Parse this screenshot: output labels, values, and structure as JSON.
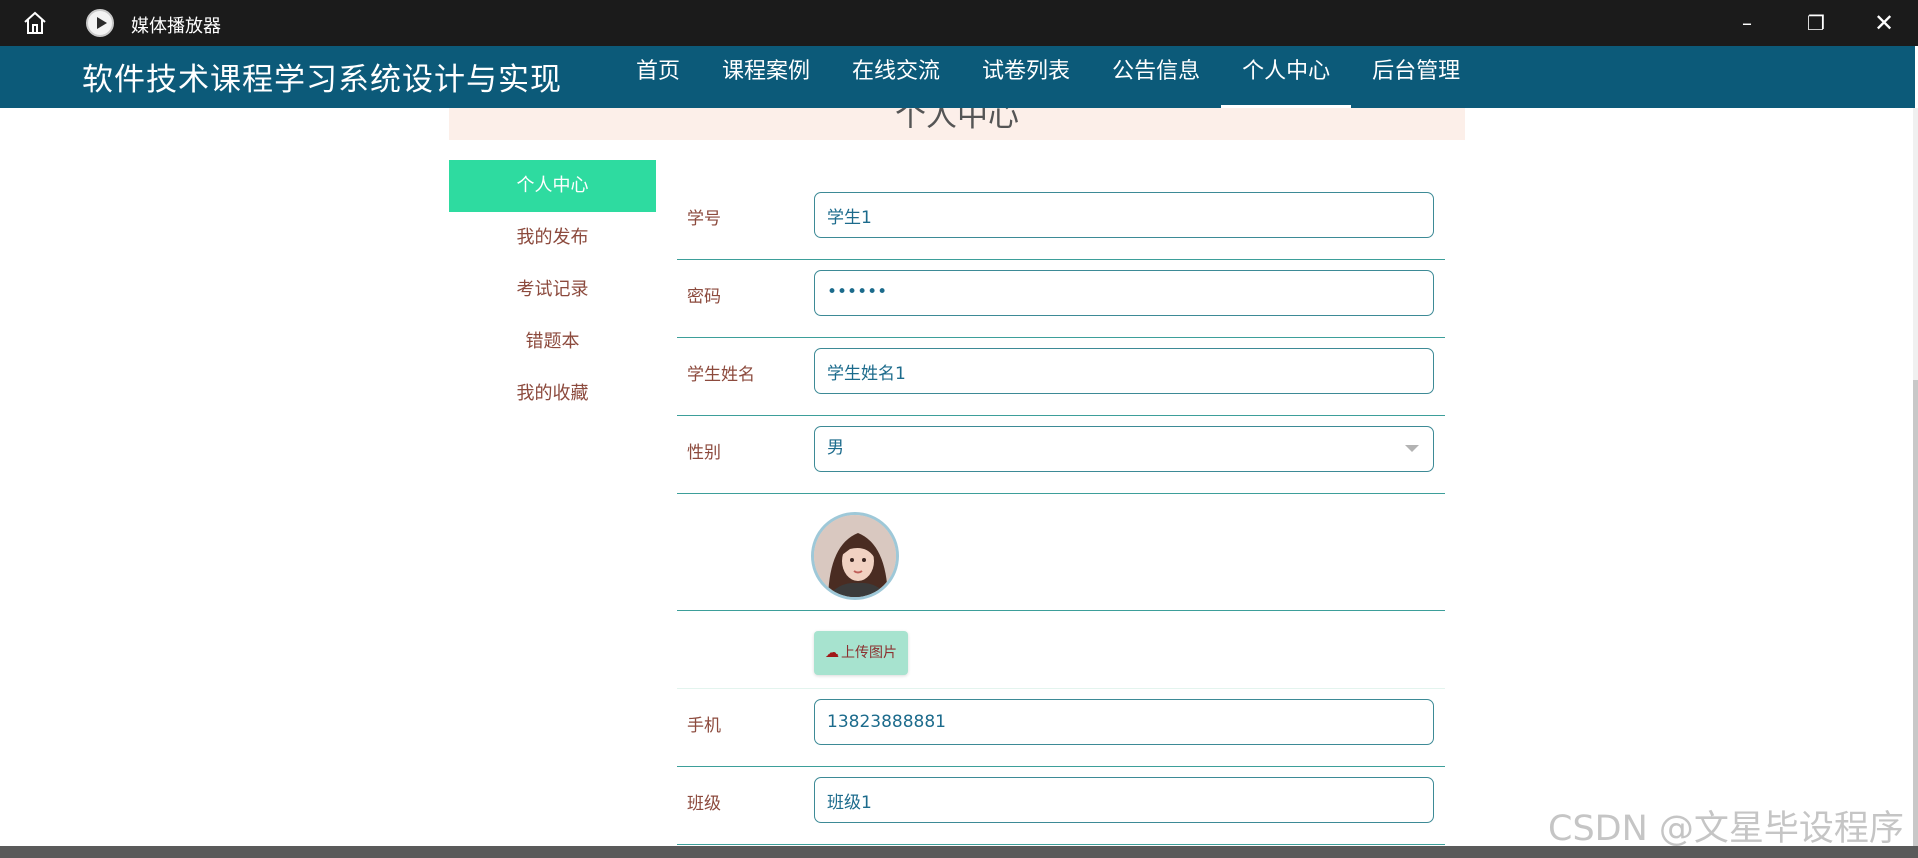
{
  "window": {
    "title": "媒体播放器",
    "icons": {
      "home": "home-icon",
      "app": "media-player-icon"
    },
    "controls": {
      "minimize": "–",
      "maximize": "❐",
      "close": "✕"
    }
  },
  "app": {
    "brand": "软件技术课程学习系统设计与实现",
    "menu": [
      "首页",
      "课程案例",
      "在线交流",
      "试卷列表",
      "公告信息",
      "个人中心",
      "后台管理"
    ],
    "active_menu": "个人中心",
    "colors": {
      "nav": "#0c5a79",
      "active_sidebar": "#2edba0",
      "label": "#8c4a3d",
      "value": "#1c6b8c"
    }
  },
  "page": {
    "title": "个人中心"
  },
  "sidebar": {
    "items": [
      "个人中心",
      "我的发布",
      "考试记录",
      "错题本",
      "我的收藏"
    ],
    "active": "个人中心"
  },
  "form": {
    "student_id": {
      "label": "学号",
      "value": "学生1"
    },
    "password": {
      "label": "密码",
      "value": "••••••"
    },
    "student_name": {
      "label": "学生姓名",
      "value": "学生姓名1"
    },
    "gender": {
      "label": "性别",
      "value": "男"
    },
    "upload_button": "上传图片",
    "phone": {
      "label": "手机",
      "value": "13823888881"
    },
    "class_name": {
      "label": "班级",
      "value": "班级1"
    }
  },
  "watermark": "CSDN @文星毕设程序"
}
